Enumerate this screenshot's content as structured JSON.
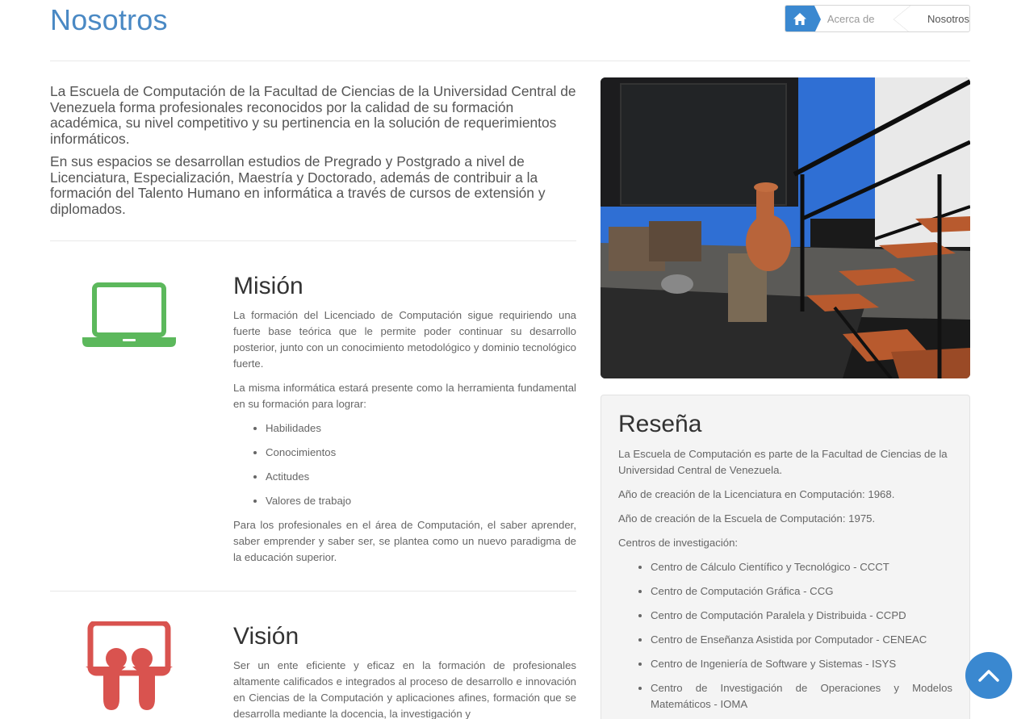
{
  "header": {
    "title": "Nosotros",
    "breadcrumb": [
      {
        "label": "home",
        "icon": "home-icon"
      },
      {
        "label": "Acerca de"
      },
      {
        "label": "Nosotros"
      }
    ]
  },
  "intro": {
    "paragraphs": [
      "La Escuela de Computación de la Facultad de Ciencias de la Universidad Central de Venezuela forma profesionales reconocidos por la calidad de su formación académica, su nivel competitivo y su pertinencia en la solución de requerimientos informáticos.",
      "En sus espacios se desarrollan estudios de Pregrado y Postgrado a nivel de Licenciatura, Especialización, Maestría y Doctorado, además de contribuir a la formación del Talento Humano en  informática a través de cursos de extensión y diplomados."
    ]
  },
  "mision": {
    "title": "Misión",
    "icon": "laptop-icon",
    "p1": "La formación del Licenciado de Computación sigue requiriendo una fuerte base teórica que le permite poder continuar su desarrollo posterior, junto con un conocimiento metodológico y dominio tecnológico fuerte.",
    "p2": "La misma informática estará presente como la herramienta fundamental en su formación para lograr:",
    "items": [
      "Habilidades",
      "Conocimientos",
      "Actitudes",
      "Valores de trabajo"
    ],
    "p3": "Para los profesionales en el área de Computación, el saber aprender, saber emprender y saber ser, se plantea como un nuevo paradigma de la educación superior."
  },
  "vision": {
    "title": "Visión",
    "icon": "slideshare-icon",
    "p1": "Ser un ente eficiente y eficaz en la formación de profesionales altamente calificados e integrados al proceso de desarrollo e innovación en Ciencias de la Computación y aplicaciones afines, formación que se desarrolla mediante la docencia, la investigación y"
  },
  "resena": {
    "title": "Reseña",
    "p1": "La Escuela de Computación es parte de la Facultad de Ciencias de la Universidad Central de Venezuela.",
    "p2": "Año de creación de la Licenciatura en Computación: 1968.",
    "p3": "Año de creación de la Escuela de Computación: 1975.",
    "p4": "Centros de investigación:",
    "centros": [
      "Centro de Cálculo Científico y Tecnológico - CCCT",
      "Centro de Computación Gráfica - CCG",
      "Centro de Computación Paralela y Distribuida - CCPD",
      "Centro de Enseñanza Asistida por Computador - CENEAC",
      "Centro de Ingeniería de Software y Sistemas - ISYS",
      "Centro de Investigación de Operaciones y Modelos Matemáticos - IOMA"
    ]
  },
  "colors": {
    "title_blue": "#4a89c4",
    "accent_blue": "#3a88d0",
    "laptop_green": "#5cb85c",
    "slideshare_red": "#d9534f"
  },
  "scroll_top": {
    "icon": "chevron-up-icon"
  }
}
